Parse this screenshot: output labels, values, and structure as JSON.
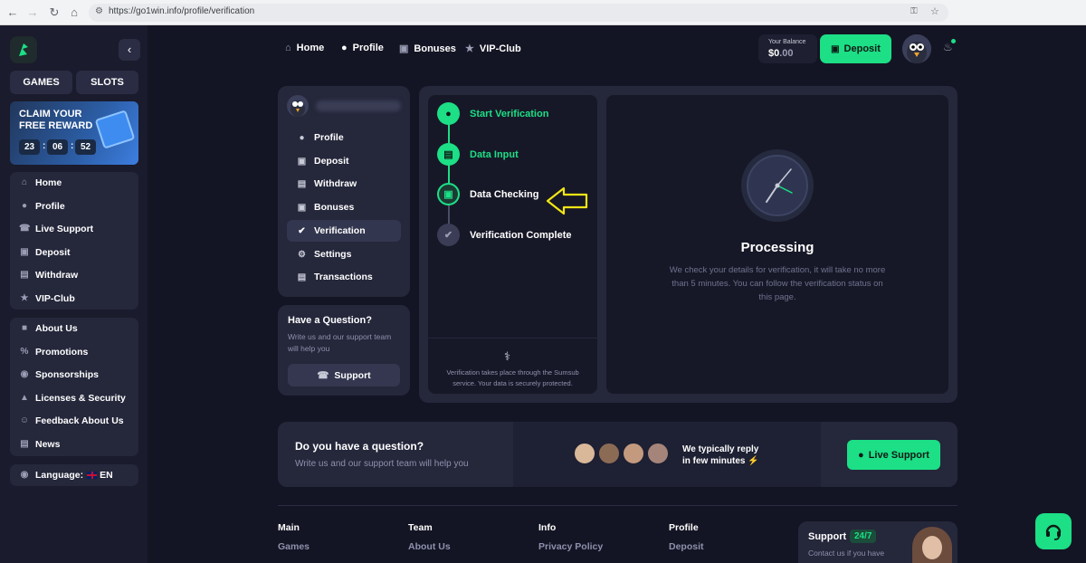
{
  "browser": {
    "url": "https://go1win.info/profile/verification"
  },
  "sidebar": {
    "tabs": [
      {
        "label": "GAMES"
      },
      {
        "label": "SLOTS"
      }
    ],
    "reward": {
      "title": "CLAIM YOUR FREE REWARD",
      "timer": [
        "23",
        "06",
        "52"
      ]
    },
    "menu1": [
      {
        "label": "Home",
        "icon": "home-icon"
      },
      {
        "label": "Profile",
        "icon": "user-icon"
      },
      {
        "label": "Live Support",
        "icon": "headset-icon"
      },
      {
        "label": "Deposit",
        "icon": "wallet-icon"
      },
      {
        "label": "Withdraw",
        "icon": "cart-icon"
      },
      {
        "label": "VIP-Club",
        "icon": "star-icon"
      }
    ],
    "menu2": [
      {
        "label": "About Us",
        "icon": "book-icon"
      },
      {
        "label": "Promotions",
        "icon": "percent-icon"
      },
      {
        "label": "Sponsorships",
        "icon": "trophy-icon"
      },
      {
        "label": "Licenses & Security",
        "icon": "shield-icon"
      },
      {
        "label": "Feedback About Us",
        "icon": "feedback-icon"
      },
      {
        "label": "News",
        "icon": "news-icon"
      }
    ],
    "language": {
      "label": "Language:",
      "value": "EN"
    }
  },
  "topnav": [
    {
      "label": "Home",
      "icon": "home-icon"
    },
    {
      "label": "Profile",
      "icon": "user-icon"
    },
    {
      "label": "Bonuses",
      "icon": "gift-icon"
    },
    {
      "label": "VIP-Club",
      "icon": "star-icon"
    }
  ],
  "header": {
    "balance_label": "Your Balance",
    "balance_dollars": "$0",
    "balance_cents": ".00",
    "deposit_label": "Deposit"
  },
  "profile_menu": [
    {
      "label": "Profile"
    },
    {
      "label": "Deposit"
    },
    {
      "label": "Withdraw"
    },
    {
      "label": "Bonuses"
    },
    {
      "label": "Verification",
      "active": true
    },
    {
      "label": "Settings"
    },
    {
      "label": "Transactions"
    }
  ],
  "question_card": {
    "title": "Have a Question?",
    "text": "Write us and our support team will help you",
    "button": "Support"
  },
  "steps": [
    {
      "label": "Start Verification",
      "state": "done"
    },
    {
      "label": "Data Input",
      "state": "done"
    },
    {
      "label": "Data Checking",
      "state": "current"
    },
    {
      "label": "Verification Complete",
      "state": "pending"
    }
  ],
  "sumsub_note": "Verification takes place through the Sumsub service. Your data is securely protected.",
  "processing": {
    "title": "Processing",
    "text": "We check your details for verification, it will take no more than 5 minutes. You can follow the verification status on this page."
  },
  "support_banner": {
    "title": "Do you have a question?",
    "subtitle": "Write us and our support team will help you",
    "reply_line1": "We typically reply",
    "reply_line2": "in few minutes",
    "button": "Live Support"
  },
  "footer": {
    "columns": [
      {
        "title": "Main",
        "link": "Games"
      },
      {
        "title": "Team",
        "link": "About Us"
      },
      {
        "title": "Info",
        "link": "Privacy Policy"
      },
      {
        "title": "Profile",
        "link": "Deposit"
      }
    ],
    "support_card": {
      "title": "Support",
      "badge": "24/7",
      "text": "Contact us if you have"
    }
  },
  "colors": {
    "accent": "#1cdf86",
    "background": "#141524",
    "panel": "#25273b",
    "annotation_arrow": "#f2e614"
  }
}
